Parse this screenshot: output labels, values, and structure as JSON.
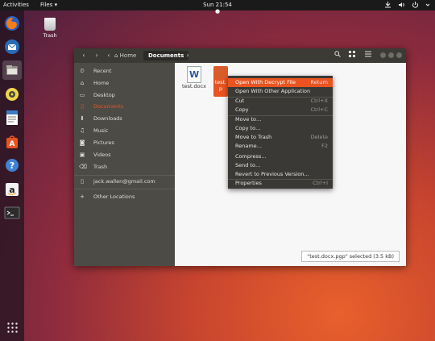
{
  "topbar": {
    "activities": "Activities",
    "files_menu": "Files ▾",
    "clock": "Sun 21:54 ●",
    "sys_icons": [
      "network-icon",
      "volume-icon",
      "power-icon"
    ]
  },
  "desktop": {
    "trash_label": "Trash"
  },
  "dock": {
    "apps": [
      "firefox",
      "thunderbird",
      "files",
      "rhythmbox",
      "libreoffice-writer",
      "software-center",
      "help",
      "amazon",
      "terminal"
    ]
  },
  "window": {
    "breadcrumb": {
      "home": "Home",
      "current": "Documents"
    },
    "sidebar": {
      "places": [
        {
          "icon": "⏲",
          "label": "Recent"
        },
        {
          "icon": "⌂",
          "label": "Home"
        },
        {
          "icon": "▭",
          "label": "Desktop"
        },
        {
          "icon": "▯",
          "label": "Documents",
          "selected": true
        },
        {
          "icon": "⬇",
          "label": "Downloads"
        },
        {
          "icon": "♫",
          "label": "Music"
        },
        {
          "icon": "◙",
          "label": "Pictures"
        },
        {
          "icon": "▣",
          "label": "Videos"
        },
        {
          "icon": "⌫",
          "label": "Trash"
        }
      ],
      "account": {
        "icon": "▯",
        "label": "jack.wallen@gmail.com"
      },
      "other": {
        "icon": "+",
        "label": "Other Locations"
      }
    },
    "files": [
      {
        "name": "test.docx"
      },
      {
        "name": "test.docx.pgp",
        "visible_label_top": "test.",
        "visible_label_bottom": "p"
      }
    ],
    "status": "\"test.docx.pgp\" selected (3.5 kB)"
  },
  "context_menu": {
    "items": [
      {
        "label": "Open With Decrypt File",
        "shortcut": "Return",
        "highlight": true
      },
      {
        "label": "Open With Other Application",
        "shortcut": ""
      },
      {
        "sep": true
      },
      {
        "label": "Cut",
        "shortcut": "Ctrl+X"
      },
      {
        "label": "Copy",
        "shortcut": "Ctrl+C"
      },
      {
        "sep": true
      },
      {
        "label": "Move to…",
        "shortcut": ""
      },
      {
        "label": "Copy to…",
        "shortcut": ""
      },
      {
        "label": "Move to Trash",
        "shortcut": "Delete"
      },
      {
        "label": "Rename…",
        "shortcut": "F2"
      },
      {
        "label": "Compress…",
        "shortcut": ""
      },
      {
        "label": "Send to…",
        "shortcut": ""
      },
      {
        "label": "Revert to Previous Version…",
        "shortcut": ""
      },
      {
        "sep": true
      },
      {
        "label": "Properties",
        "shortcut": "Ctrl+I"
      }
    ]
  },
  "colors": {
    "accent": "#e95420",
    "header": "#3b3a35",
    "sidebar": "#4d4b45",
    "menu": "#3a3935"
  }
}
